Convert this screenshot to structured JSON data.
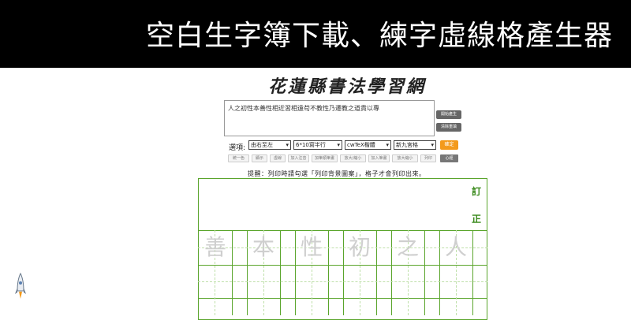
{
  "banner": {
    "title": "空白生字簿下載、練字虛線格產生器"
  },
  "site": {
    "logo_text": "花蓮縣書法學習網"
  },
  "input": {
    "text": "人之初性本善性相近習相遠苟不教性乃遷教之道貴以專"
  },
  "side_buttons": [
    "開始產生",
    "清除重填"
  ],
  "options": {
    "label": "選項:",
    "selects": [
      "由右至左",
      "6*10寫半行",
      "cwTeX楷體",
      "新九宮格"
    ],
    "confirm_label": "確定"
  },
  "toolbar": [
    "統一色",
    "顯示",
    "虛線",
    "加入注音",
    "加筆順筆畫",
    "放大/縮小",
    "加入筆畫",
    "放大縮小",
    "列印",
    "心經"
  ],
  "hint": "提醒：列印時請勾選「列印背景圖案」，格子才會列印出來。",
  "sheet": {
    "correction_chars": [
      "訂",
      "正"
    ],
    "trace_chars": [
      "善",
      "本",
      "性",
      "初",
      "之",
      "人"
    ]
  },
  "colors": {
    "banner": "#000000",
    "grid": "#5aa52c",
    "accent": "#f39a1c"
  },
  "icons": {
    "rocket": "rocket-icon"
  }
}
